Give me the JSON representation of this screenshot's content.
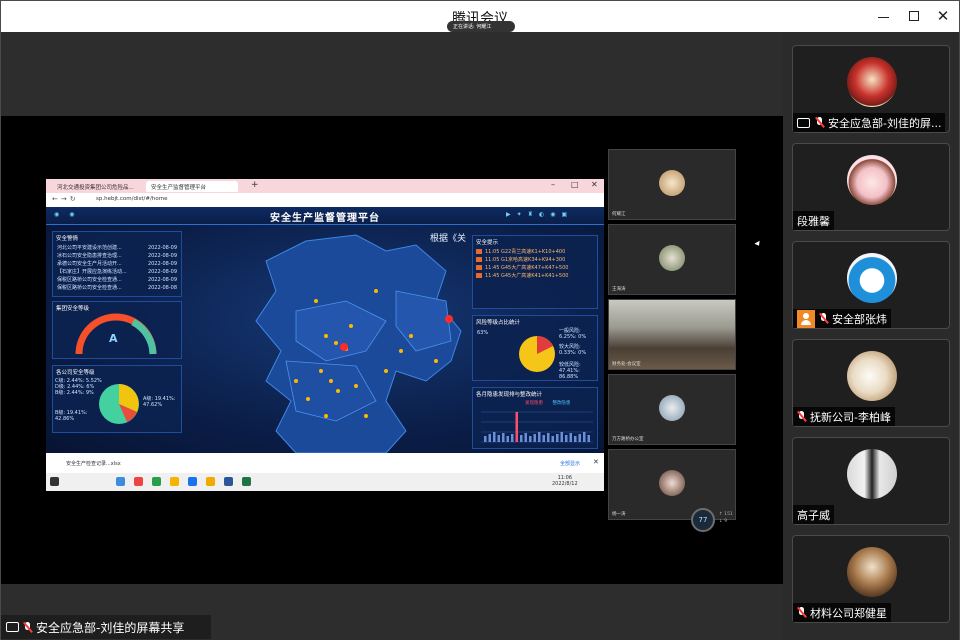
{
  "window": {
    "title": "腾讯会议"
  },
  "shared_screen": {
    "tabs": [
      "河北交通投资集团公司危险品...",
      "安全生产监督管理平台"
    ],
    "url": "sp.hebjt.com/dist/#/home",
    "recording_pill": "正在讲话: 何耀江",
    "dashboard": {
      "title": "安全生产监督管理平台",
      "overlay_text": "根据《关",
      "notice_panel": {
        "title": "安全警情",
        "items": [
          {
            "text": "河北公司平安建设示范创建...",
            "date": "2022-08-09"
          },
          {
            "text": "冰石公司安全隐患排查治理...",
            "date": "2022-08-09"
          },
          {
            "text": "承德公司安全生产月活动开...",
            "date": "2022-08-09"
          },
          {
            "text": "【石家庄】开展应急演练活动...",
            "date": "2022-08-09"
          },
          {
            "text": "保税区路桥公司安全检查通...",
            "date": "2022-08-09"
          },
          {
            "text": "保税区路桥公司安全检查通...",
            "date": "2022-08-08"
          }
        ]
      },
      "gauge_panel": {
        "title": "集团安全等级",
        "value": "A"
      },
      "pie_left_panel": {
        "title": "各公司安全等级",
        "labels": [
          "C级: 2.44%: 5.52%",
          "D级: 2.44%: 6%",
          "B级: 2.44%: 9%",
          "A级: 19.41%: 47.62%",
          "B级: 19.41%: 42.86%"
        ]
      },
      "alarm_panel": {
        "title": "安全提示",
        "items": [
          "11:05 G22青兰高速K1+K10+400",
          "11:05 G1京哈高速K34+K94+300",
          "11:45 G45大广高速K47+K47+500",
          "11:45 G45大广高速K41+K41+500"
        ]
      },
      "pie_right_panel": {
        "title": "风险等级占比统计",
        "labels": [
          "一般风险: 6.25%: 0%",
          "较低风险: 47.41%: 86.88%",
          "较大风险: 0.33%: 0%",
          "63%"
        ]
      },
      "bar_panel": {
        "title": "各月隐患发现排与整改统计",
        "legend": [
          "发现隐患",
          "整改隐患"
        ]
      }
    },
    "download_bar": {
      "file": "安全生产检查记录...xlsx",
      "show_all": "全部显示"
    },
    "taskbar": {
      "time": "11:06",
      "date": "2022/8/12"
    }
  },
  "stage_thumbs": [
    {
      "name": "何耀江"
    },
    {
      "name": "王海涛"
    },
    {
      "name": "财务处-会议室"
    },
    {
      "name": "万方路桥办公室"
    },
    {
      "name": "杨一涛"
    }
  ],
  "network": {
    "value": "77",
    "lines": [
      "↑ 151",
      "↓ 9"
    ]
  },
  "share_label": "安全应急部-刘佳的屏幕共享",
  "participants": [
    {
      "name": "安全应急部-刘佳的屏...",
      "icons": [
        "share",
        "mic-off"
      ],
      "avatar": "cake"
    },
    {
      "name": "段雅馨",
      "icons": [],
      "avatar": "anime-girl"
    },
    {
      "name": "安全部张炜",
      "icons": [
        "host",
        "mic-off"
      ],
      "avatar": "doraemon"
    },
    {
      "name": "抚新公司-李柏峰",
      "icons": [
        "mic-off"
      ],
      "avatar": "cat"
    },
    {
      "name": "高子威",
      "icons": [],
      "avatar": "person"
    },
    {
      "name": "材料公司郑健星",
      "icons": [
        "mic-off"
      ],
      "avatar": "interior"
    }
  ]
}
